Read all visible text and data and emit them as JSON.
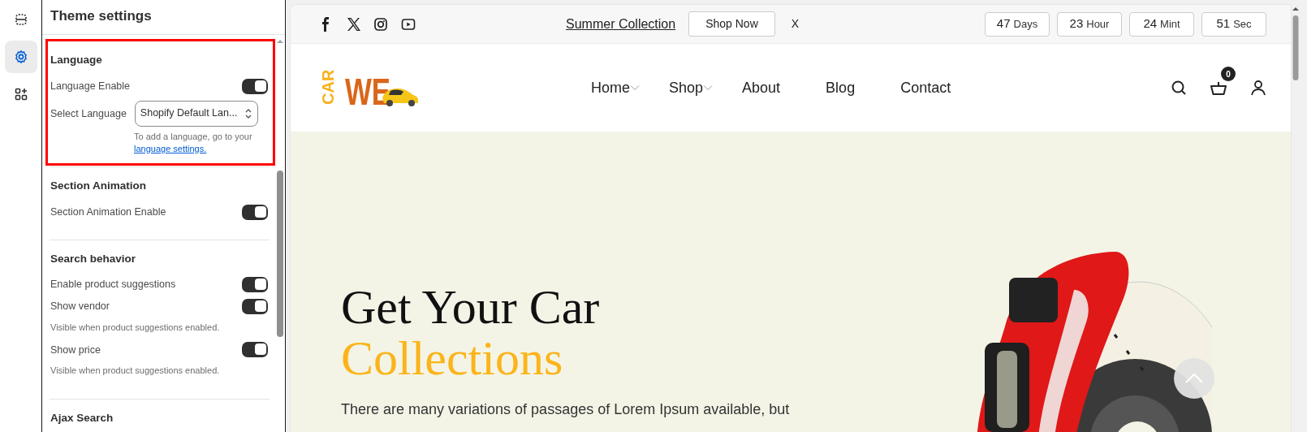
{
  "rail": {
    "items": [
      {
        "kind": "sections",
        "selected": false
      },
      {
        "kind": "settings",
        "selected": true
      },
      {
        "kind": "apps",
        "selected": false
      }
    ]
  },
  "panel": {
    "title": "Theme settings",
    "sections": [
      {
        "title": "Language",
        "highlighted": true,
        "settings": [
          {
            "kind": "toggle",
            "label": "Language Enable",
            "on": true
          },
          {
            "kind": "select",
            "label": "Select Language",
            "value": "Shopify Default Lan...",
            "help_text": "To add a language, go to your",
            "help_link": "language settings."
          }
        ]
      },
      {
        "title": "Section Animation",
        "highlighted": false,
        "settings": [
          {
            "kind": "toggle",
            "label": "Section Animation Enable",
            "on": true
          }
        ]
      },
      {
        "title": "Search behavior",
        "highlighted": false,
        "settings": [
          {
            "kind": "toggle",
            "label": "Enable product suggestions",
            "on": true
          },
          {
            "kind": "toggle",
            "label": "Show vendor",
            "on": true,
            "help_text": "Visible when product suggestions enabled."
          },
          {
            "kind": "toggle",
            "label": "Show price",
            "on": true,
            "help_text": "Visible when product suggestions enabled."
          }
        ]
      },
      {
        "title": "Ajax Search",
        "highlighted": false
      }
    ]
  },
  "preview": {
    "announcement": {
      "social": [
        {
          "kind": "facebook"
        },
        {
          "kind": "x"
        },
        {
          "kind": "instagram"
        },
        {
          "kind": "youtube"
        }
      ],
      "link": "Summer Collection",
      "button": "Shop Now",
      "close": "X",
      "countdown": [
        {
          "value": "47",
          "unit": "Days"
        },
        {
          "value": "23",
          "unit": "Hour"
        },
        {
          "value": "24",
          "unit": "Mint"
        },
        {
          "value": "51",
          "unit": "Sec"
        }
      ]
    },
    "header": {
      "logo": {
        "text_1": "CAR",
        "text_2": "WE"
      },
      "nav": [
        {
          "label": "Home",
          "dropdown": true
        },
        {
          "label": "Shop",
          "dropdown": true
        },
        {
          "label": "About",
          "dropdown": false
        },
        {
          "label": "Blog",
          "dropdown": false
        },
        {
          "label": "Contact",
          "dropdown": false
        }
      ],
      "cart_count": "0"
    },
    "hero": {
      "title_line_1": "Get Your Car",
      "title_line_2": "Collections",
      "text": "There are many variations of passages of Lorem Ipsum available, but"
    }
  }
}
